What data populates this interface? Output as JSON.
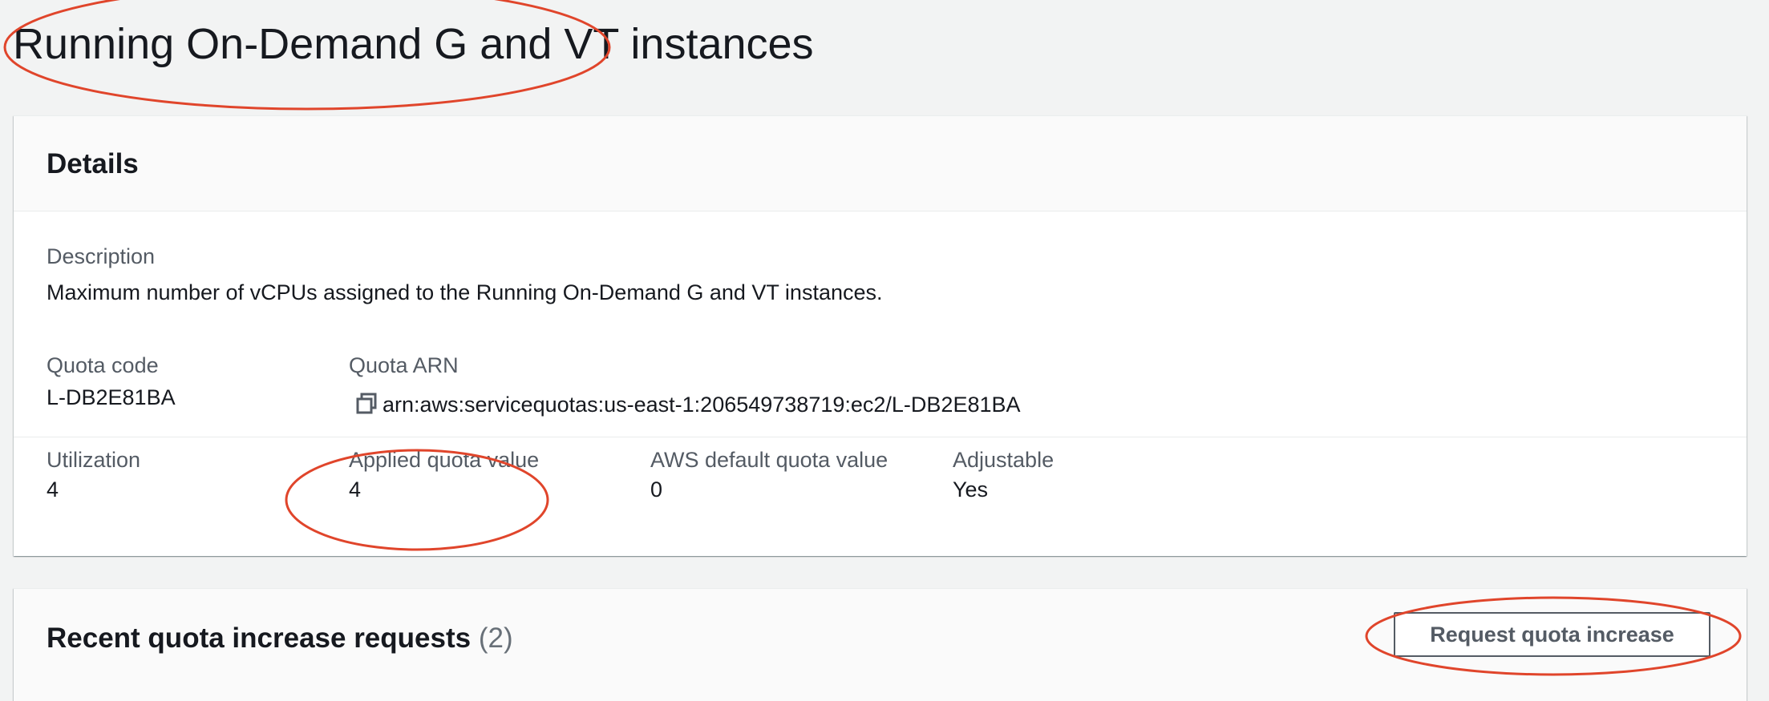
{
  "page": {
    "title": "Running On-Demand G and VT instances"
  },
  "details": {
    "heading": "Details",
    "description_label": "Description",
    "description_value": "Maximum number of vCPUs assigned to the Running On-Demand G and VT instances.",
    "quota_code_label": "Quota code",
    "quota_code_value": "L-DB2E81BA",
    "quota_arn_label": "Quota ARN",
    "quota_arn_value": "arn:aws:servicequotas:us-east-1:206549738719:ec2/L-DB2E81BA",
    "utilization_label": "Utilization",
    "utilization_value": "4",
    "applied_quota_label": "Applied quota value",
    "applied_quota_value": "4",
    "default_quota_label": "AWS default quota value",
    "default_quota_value": "0",
    "adjustable_label": "Adjustable",
    "adjustable_value": "Yes"
  },
  "requests": {
    "heading": "Recent quota increase requests",
    "count": "(2)",
    "button_label": "Request quota increase"
  },
  "icons": {
    "copy": "copy-icon"
  },
  "colors": {
    "annotation": "#e0452b",
    "button_border": "#545b64",
    "page_background": "#f2f3f3"
  }
}
